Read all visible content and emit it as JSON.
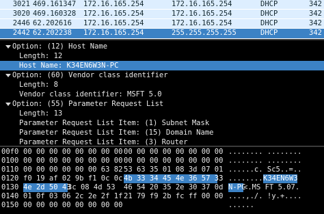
{
  "packets": [
    {
      "no": "3021",
      "time": "469.161347",
      "source": "172.16.165.254",
      "destination": "172.16.165.254",
      "protocol": "DHCP",
      "length": "342"
    },
    {
      "no": "3020",
      "time": "469.160328",
      "source": "172.16.165.254",
      "destination": "172.16.165.254",
      "protocol": "DHCP",
      "length": "342"
    },
    {
      "no": "2446",
      "time": "62.202616",
      "source": "172.16.165.254",
      "destination": "172.16.165.254",
      "protocol": "DHCP",
      "length": "342"
    },
    {
      "no": "2442",
      "time": "62.202238",
      "source": "172.16.165.254",
      "destination": "255.255.255.255",
      "protocol": "DHCP",
      "length": "342"
    }
  ],
  "details": [
    {
      "text": "Option: (12) Host Name"
    },
    {
      "text": "Length: 12"
    },
    {
      "text": "Host Name: K34EN6W3N-PC"
    },
    {
      "text": "Option: (60) Vendor class identifier"
    },
    {
      "text": "Length: 8"
    },
    {
      "text": "Vendor class identifier: MSFT 5.0"
    },
    {
      "text": "Option: (55) Parameter Request List"
    },
    {
      "text": "Length: 13"
    },
    {
      "text": "Parameter Request List Item: (1) Subnet Mask"
    },
    {
      "text": "Parameter Request List Item: (15) Domain Name"
    },
    {
      "text": "Parameter Request List Item: (3) Router"
    }
  ],
  "bytes": [
    {
      "offset": "00f0",
      "hex1": "00 00 00 00 00 00 00 00",
      "hex2": "00 00 00 00 00 00 00 00",
      "ascii": "........ ........"
    },
    {
      "offset": "0100",
      "hex1": "00 00 00 00 00 00 00 00",
      "hex2": "00 00 00 00 00 00 00 00",
      "ascii": "........ ........"
    },
    {
      "offset": "0110",
      "hex1": "00 00 00 00 00 00 63 82",
      "hex2": "53 63 35 01 08 3d 07 01",
      "ascii": "......c. Sc5..=.."
    },
    {
      "offset": "0120",
      "hex1": "f0 19 af 02 9b f1 0c 0c",
      "hex2": "",
      "ascii": "........"
    },
    {
      "offset": "0130",
      "hex1": "4e 2d 50 43",
      "hex1_rest": " 3c 08 4d 53",
      "hex2": "46 54 20 35 2e 30 37 0d",
      "ascii": "N-PC",
      "ascii_rest": "<.MS FT 5.07."
    },
    {
      "offset": "0140",
      "hex1": "01 0f 03 06 2c 2e 2f 1f",
      "hex2": "21 79 f9 2b fc ff 00 00",
      "ascii": "....,./. !y.+...."
    },
    {
      "offset": "0150",
      "hex1": "00 00 00 00 00 00 00 00",
      "hex2": "",
      "ascii": "......"
    }
  ],
  "bytes_highlight": {
    "row0120_hex2": "4b 33 34 45 4e 36 57 33",
    "row0120_ascii": "K34EN6W3"
  }
}
